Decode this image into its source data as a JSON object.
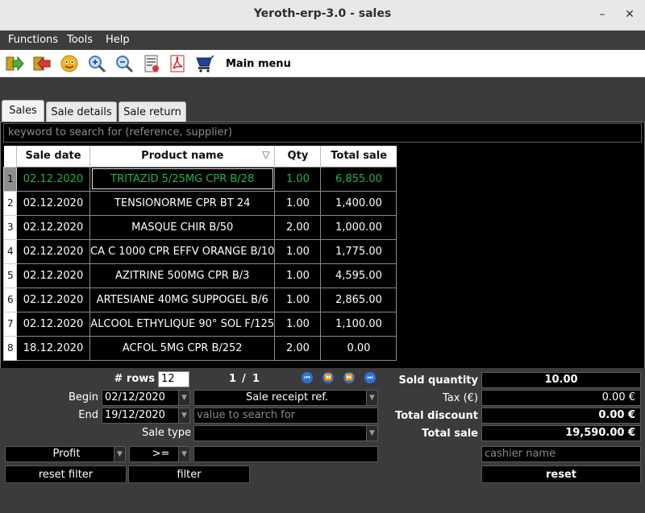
{
  "window": {
    "title": "Yeroth-erp-3.0 - sales",
    "minimize": "–",
    "close": "✕"
  },
  "menu": [
    "Functions",
    "Tools",
    "Help"
  ],
  "toolbar": {
    "icons": [
      "exit-icon",
      "back-icon",
      "smiley-icon",
      "zoom-in-icon",
      "zoom-out-icon",
      "report-icon",
      "pdf-icon",
      "cashier-icon"
    ],
    "main_menu_label": "Main menu"
  },
  "tabs": [
    "Sales",
    "Sale details",
    "Sale return"
  ],
  "search": {
    "placeholder": "keyword to search for (reference, supplier)"
  },
  "table": {
    "columns": [
      "Sale date",
      "Product name",
      "Qty",
      "Total sale"
    ],
    "rows": [
      {
        "n": "1",
        "date": "02.12.2020",
        "product": "TRITAZID 5/25MG CPR B/28",
        "qty": "1.00",
        "total": "6,855.00"
      },
      {
        "n": "2",
        "date": "02.12.2020",
        "product": "TENSIONORME CPR BT 24",
        "qty": "1.00",
        "total": "1,400.00"
      },
      {
        "n": "3",
        "date": "02.12.2020",
        "product": "MASQUE CHIR B/50",
        "qty": "2.00",
        "total": "1,000.00"
      },
      {
        "n": "4",
        "date": "02.12.2020",
        "product": "CA C 1000 CPR EFFV ORANGE B/10",
        "qty": "1.00",
        "total": "1,775.00"
      },
      {
        "n": "5",
        "date": "02.12.2020",
        "product": "AZITRINE 500MG CPR B/3",
        "qty": "1.00",
        "total": "4,595.00"
      },
      {
        "n": "6",
        "date": "02.12.2020",
        "product": "ARTESIANE 40MG SUPPOGEL B/6",
        "qty": "1.00",
        "total": "2,865.00"
      },
      {
        "n": "7",
        "date": "02.12.2020",
        "product": "ALCOOL ETHYLIQUE 90° SOL F/125",
        "qty": "1.00",
        "total": "1,100.00"
      },
      {
        "n": "8",
        "date": "18.12.2020",
        "product": "ACFOL 5MG CPR B/252",
        "qty": "2.00",
        "total": "0.00"
      }
    ]
  },
  "filters": {
    "rows_label": "# rows",
    "rows_value": "12",
    "page": "1",
    "page_sep": "/",
    "page_total": "1",
    "begin_label": "Begin",
    "begin_value": "02/12/2020",
    "end_label": "End",
    "end_value": "19/12/2020",
    "receipt_combo": "Sale receipt ref.",
    "search_value_placeholder": "value to search for",
    "sale_type_label": "Sale type",
    "profit_combo": "Profit",
    "operator_combo": ">=",
    "reset_filter": "reset filter",
    "filter": "filter"
  },
  "summary": {
    "sold_quantity_label": "Sold quantity",
    "sold_quantity": "10.00",
    "tax_label": "Tax (€)",
    "tax": "0.00 €",
    "total_discount_label": "Total discount",
    "total_discount": "0.00 €",
    "total_sale_label": "Total sale",
    "total_sale": "19,590.00 €",
    "cashier_placeholder": "cashier name",
    "reset": "reset"
  },
  "colors": {
    "selected_row_text": "#22b34a",
    "nav_button": "#2f6fd6"
  }
}
